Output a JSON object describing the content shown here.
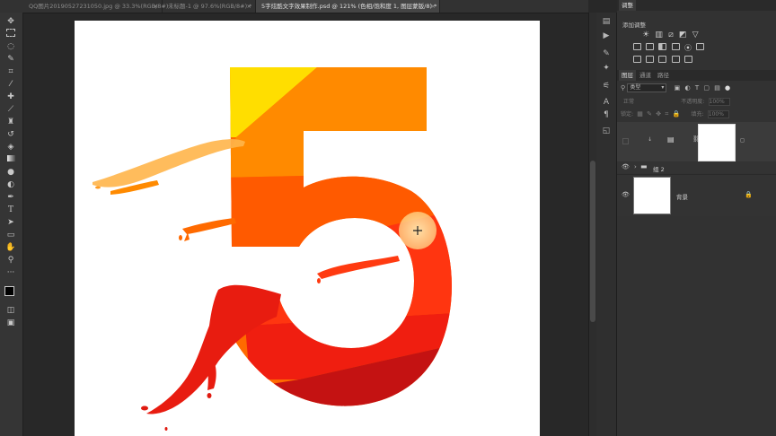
{
  "tabs": [
    {
      "label": "QQ图片20190527231050.jpg @ 33.3%(RGB/8#)",
      "close": "×"
    },
    {
      "label": "未标题-1 @ 97.6%(RGB/8#) *",
      "close": "×"
    },
    {
      "label": "5字炫酷文字效果制作.psd @ 121% (色相/饱和度 1, 图层蒙版/8) *",
      "close": "×"
    }
  ],
  "tools": [
    "move-tool-icon",
    "marquee-tool-icon",
    "lasso-tool-icon",
    "quick-select-tool-icon",
    "crop-tool-icon",
    "eyedropper-tool-icon",
    "healing-brush-icon",
    "brush-tool-icon",
    "clone-stamp-icon",
    "history-brush-icon",
    "eraser-tool-icon",
    "gradient-tool-icon",
    "blur-tool-icon",
    "dodge-tool-icon",
    "pen-tool-icon",
    "type-tool-icon",
    "path-select-icon",
    "shape-tool-icon",
    "hand-tool-icon",
    "zoom-tool-icon",
    "more-tools-icon",
    "colors-icon",
    "quick-mask-icon",
    "screen-mode-icon"
  ],
  "tool_glyphs": {
    "type_tool": "T"
  },
  "panels": {
    "adjustments": {
      "tab": "调整",
      "subtitle": "添加调整"
    },
    "layers": {
      "tabs": [
        "图层",
        "通道",
        "路径"
      ],
      "filter_label": "类型",
      "blend_mode": "正常",
      "opacity_label": "不透明度:",
      "opacity_value": "100%",
      "lock_label": "锁定:",
      "fill_label": "填充:",
      "fill_value": "100%",
      "items": [
        {
          "name": "",
          "type": "adjustment",
          "visible": false
        },
        {
          "name": "组 2",
          "type": "group",
          "visible": true
        },
        {
          "name": "背景",
          "type": "background",
          "visible": true,
          "locked": true
        }
      ]
    }
  },
  "colors": {
    "yellow": "#ffde00",
    "orange": "#ff8a00",
    "orange_mid": "#ff6a00",
    "red_orange": "#ff3a10",
    "red": "#f01e10",
    "dark_red": "#c41212",
    "cursor_circle": "#ffe2a0"
  }
}
